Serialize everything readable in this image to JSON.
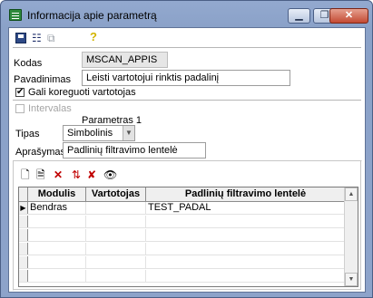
{
  "window": {
    "title": "Informacija apie parametrą",
    "minimize_glyph": "▁",
    "maximize_glyph": "❐",
    "close_glyph": "✕"
  },
  "toolbar": {
    "icons": [
      "save-icon",
      "tree-copy-icon",
      "copy-icon",
      "help-icon"
    ],
    "tree_glyph": "☷",
    "copy_glyph": "⧉",
    "help_glyph": "?"
  },
  "form": {
    "kodas_label": "Kodas",
    "kodas_value": "MSCAN_APPIS",
    "pavadinimas_label": "Pavadinimas",
    "pavadinimas_value": "Leisti vartotojui rinktis padalinį",
    "editable_check": "✔",
    "editable_label": "Gali koreguoti vartotojas",
    "intervalas_label": "Intervalas",
    "parametras_caption": "Parametras 1",
    "tipas_label": "Tipas",
    "tipas_value": "Simbolinis",
    "combo_arrow": "▼",
    "aprasymas_label": "Aprašymas",
    "aprasymas_value": "Padlinių filtravimo lentelė"
  },
  "grid_toolbar": {
    "new_glyph": "🗋",
    "edit_glyph": "🗎",
    "delete_glyph": "✕",
    "sort_glyph": "⇅",
    "delete_all_glyph": "✘",
    "find_glyph": "👁"
  },
  "grid": {
    "columns": [
      "",
      "Modulis",
      "Vartotojas",
      "Padlinių filtravimo lentelė"
    ],
    "rows": [
      {
        "indicator": "▶",
        "modulis": "Bendras",
        "vartotojas": "",
        "lentele": "TEST_PADAL"
      },
      {
        "indicator": "",
        "modulis": "",
        "vartotojas": "",
        "lentele": ""
      },
      {
        "indicator": "",
        "modulis": "",
        "vartotojas": "",
        "lentele": ""
      },
      {
        "indicator": "",
        "modulis": "",
        "vartotojas": "",
        "lentele": ""
      },
      {
        "indicator": "",
        "modulis": "",
        "vartotojas": "",
        "lentele": ""
      },
      {
        "indicator": "",
        "modulis": "",
        "vartotojas": "",
        "lentele": ""
      }
    ],
    "scroll_up": "▲",
    "scroll_down": "▼"
  },
  "colors": {
    "title_bar": "#8aa1c8",
    "close_button": "#c34a33",
    "readonly_field": "#e6e6e6"
  }
}
